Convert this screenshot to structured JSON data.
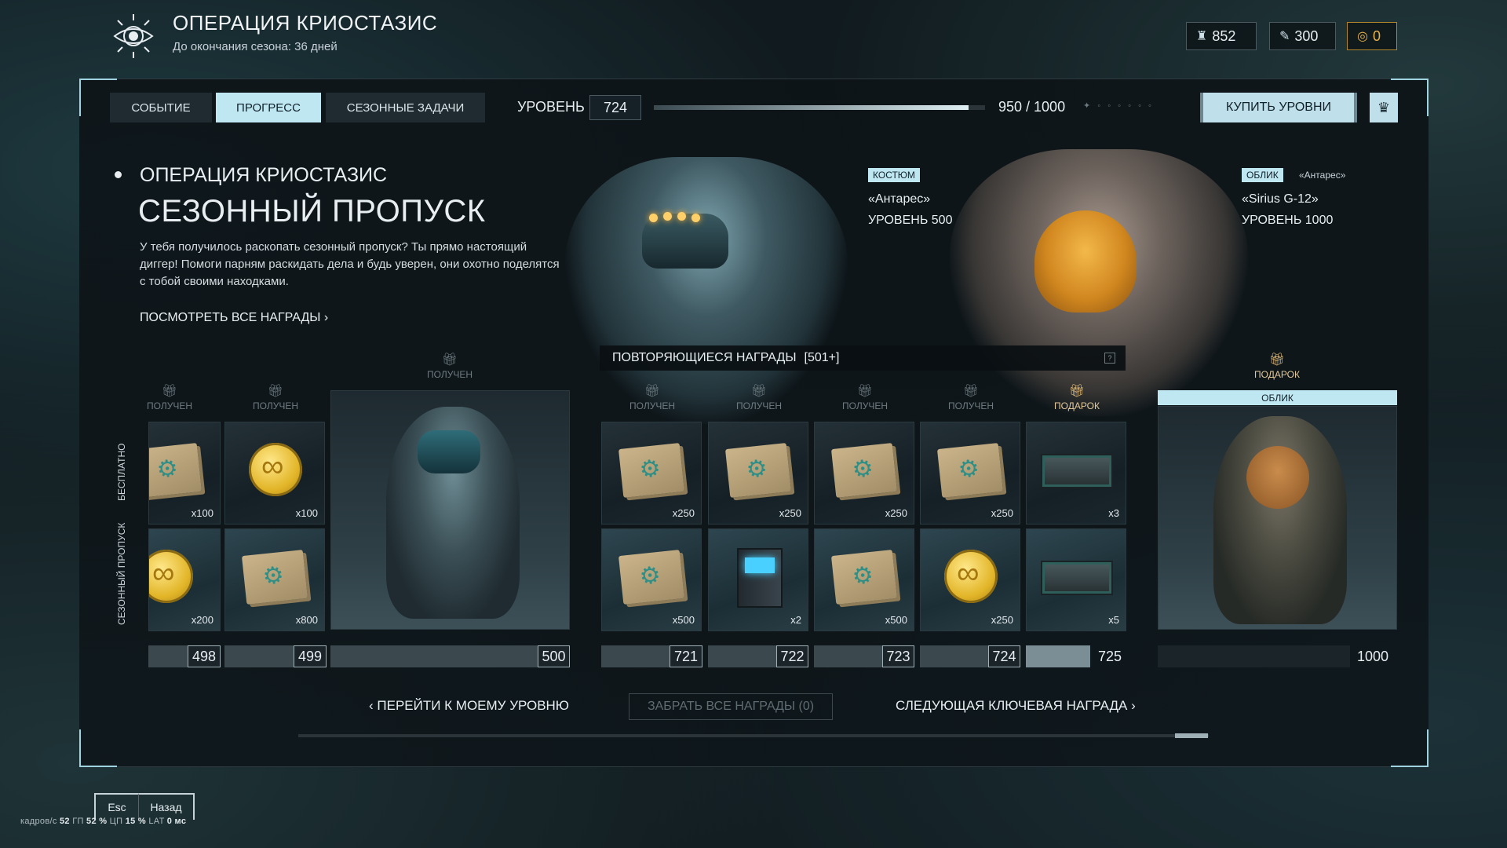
{
  "header": {
    "title": "ОПЕРАЦИЯ КРИОСТАЗИС",
    "subtitle": "До окончания сезона: 36 дней",
    "currencies": [
      {
        "icon": "crowns-icon",
        "value": "852"
      },
      {
        "icon": "feather-icon",
        "value": "300"
      },
      {
        "icon": "gold-coin-icon",
        "value": "0"
      }
    ]
  },
  "tabs": [
    {
      "label": "СОБЫТИЕ"
    },
    {
      "label": "ПРОГРЕСС"
    },
    {
      "label": "СЕЗОННЫЕ ЗАДАЧИ"
    }
  ],
  "level": {
    "label": "УРОВЕНЬ",
    "value": "724",
    "xp_text": "950 / 1000",
    "xp_fraction": 0.95,
    "buy_label": "КУПИТЬ УРОВНИ"
  },
  "intro": {
    "operation": "ОПЕРАЦИЯ КРИОСТАЗИС",
    "title": "СЕЗОННЫЙ ПРОПУСК",
    "description": "У тебя получилось раскопать сезонный пропуск? Ты прямо настоящий диггер! Помоги парням раскидать дела и будь уверен, они охотно поделятся с тобой своими находками.",
    "view_all": "ПОСМОТРЕТЬ ВСЕ НАГРАДЫ"
  },
  "costume": {
    "tag": "КОСТЮМ",
    "name": "«Антарес»",
    "level": "УРОВЕНЬ 500"
  },
  "skin": {
    "tag": "ОБЛИК",
    "owner": "«Антарес»",
    "name": "«Sirius G-12»",
    "level": "УРОВЕНЬ 1000"
  },
  "repeat": {
    "label": "ПОВТОРЯЮЩИЕСЯ НАГРАДЫ",
    "count": "[501+]"
  },
  "rows": {
    "free": "БЕСПЛАТНО",
    "premium": "СЕЗОННЫЙ ПРОПУСК"
  },
  "status": {
    "received": "ПОЛУЧЕН",
    "gift": "ПОДАРОК",
    "skin_label": "ОБЛИК"
  },
  "rewards": {
    "l498_free": "x100",
    "l498_prem": "x200",
    "l499_free": "x100",
    "l499_prem": "x800",
    "l721_free": "x250",
    "l721_prem": "x500",
    "l722_free": "x250",
    "l722_prem": "x2",
    "l723_free": "x250",
    "l723_prem": "x500",
    "l724_free": "x250",
    "l724_prem": "x250",
    "l725_free": "x3",
    "l725_prem": "x5"
  },
  "levels": [
    "498",
    "499",
    "500",
    "721",
    "722",
    "723",
    "724",
    "725",
    "1000"
  ],
  "nav": {
    "goto": "ПЕРЕЙТИ К МОЕМУ УРОВНЮ",
    "claim_all": "ЗАБРАТЬ ВСЕ НАГРАДЫ (0)",
    "next_key": "СЛЕДУЮЩАЯ КЛЮЧЕВАЯ НАГРАДА"
  },
  "footer": {
    "esc": "Esc",
    "back": "Назад",
    "perf": {
      "fps_label": "кадров/с",
      "fps": "52",
      "gpu_label": "ГП",
      "gpu": "52 %",
      "cpu_label": "ЦП",
      "cpu": "15 %",
      "lat_label": "LAT",
      "lat": "0 мс"
    }
  },
  "colors": {
    "accent": "#bfe7f2",
    "gold": "#e8b24a",
    "gift": "#e8c07a"
  }
}
